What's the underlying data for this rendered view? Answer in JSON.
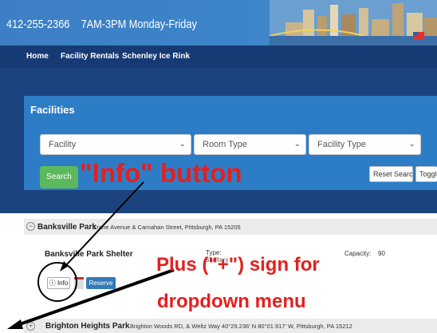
{
  "header": {
    "phone": "412-255-2366",
    "hours": "7AM-3PM Monday-Friday"
  },
  "nav": {
    "items": [
      {
        "label": "Home"
      },
      {
        "label": "Facility Rentals"
      },
      {
        "label": "Schenley Ice Rink"
      }
    ]
  },
  "facilities_panel": {
    "title": "Facilities",
    "filters": [
      {
        "selected": "Facility"
      },
      {
        "selected": "Room Type"
      },
      {
        "selected": "Facility Type"
      }
    ],
    "search_label": "Search",
    "reset_label": "Reset Search",
    "toggle_label": "Toggle"
  },
  "results": [
    {
      "park_name": "Banksville Park",
      "address": "Crane Avenue & Carnahan Street, Pittsburgh, PA 15205",
      "facility": {
        "name": "Banksville Park Shelter",
        "type_label": "Type:",
        "type_value": "Shelters",
        "capacity_label": "Capacity:",
        "capacity_value": "90",
        "info_label": "Info",
        "reserve_label": "Reserve"
      }
    },
    {
      "park_name": "Brighton Heights Park",
      "address": "Brighton Woods RD, & Weltz Way 40°29.236' N 80°01.917' W, Pittsburgh, PA 15212"
    }
  ],
  "annotations": {
    "info_button": "\"Info\" button",
    "plus_line1": "Plus (\"+\") sign for",
    "plus_line2": "dropdown menu"
  },
  "colors": {
    "topbar": "#3c84c9",
    "navbar": "#163a73",
    "panel": "#2d7dc6",
    "search_button": "#5cb85c",
    "reserve_button": "#337ab7",
    "annotation": "#e41f1f"
  }
}
